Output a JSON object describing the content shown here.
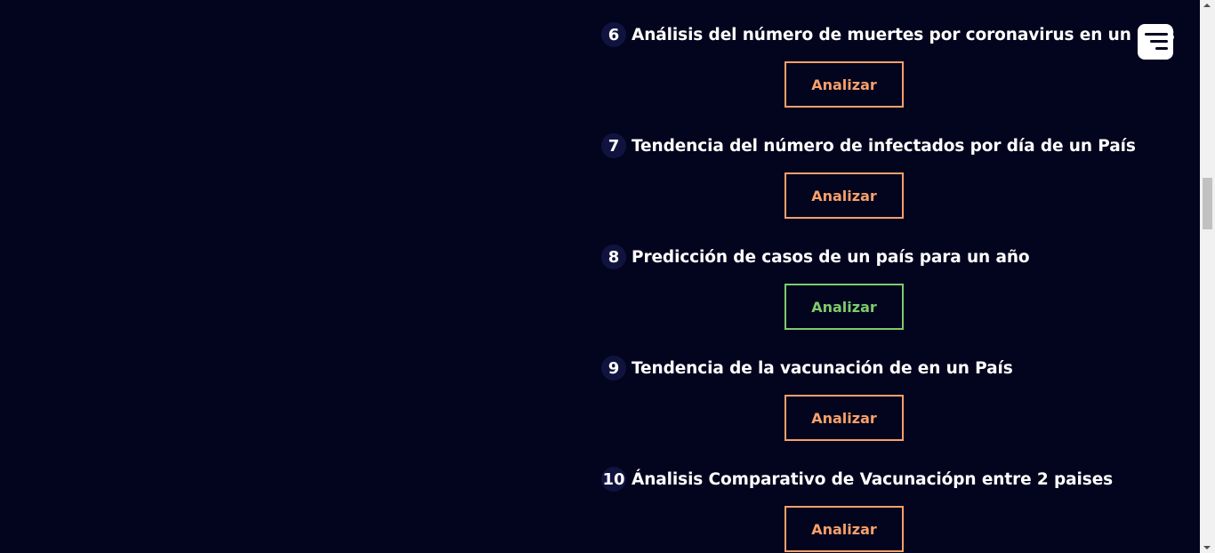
{
  "analyses": [
    {
      "number": "6",
      "title": "Análisis del número de muertes por coronavirus en un País",
      "button_label": "Analizar"
    },
    {
      "number": "7",
      "title": "Tendencia del número de infectados por día de un País",
      "button_label": "Analizar"
    },
    {
      "number": "8",
      "title": "Predicción de casos de un país para un año",
      "button_label": "Analizar"
    },
    {
      "number": "9",
      "title": "Tendencia de la vacunación de en un País",
      "button_label": "Analizar"
    },
    {
      "number": "10",
      "title": "Ánalisis Comparativo de Vacunaciópn entre 2 paises",
      "button_label": "Analizar"
    }
  ],
  "menu": {
    "icon": "menu-lines-icon"
  },
  "colors": {
    "background": "#03041e",
    "button_accent": "#f6a06b",
    "button_hover": "#7ecb6e",
    "number_badge": "#11133f"
  }
}
